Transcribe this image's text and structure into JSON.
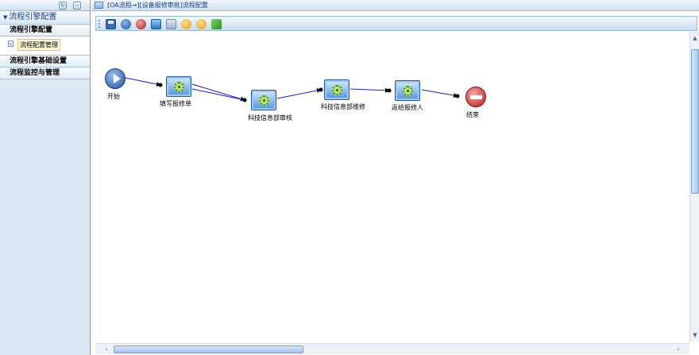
{
  "sidebar": {
    "header_title": "流程引擎配置",
    "items": [
      {
        "label": "流程引擎配置"
      },
      {
        "label": "流程配置管理"
      },
      {
        "label": "流程引擎基础设置"
      },
      {
        "label": "流程监控与管理"
      }
    ]
  },
  "main": {
    "title": "[OA流程→][设备报修审批]流程配置"
  },
  "toolbar": {
    "buttons": [
      {
        "icon": "save-icon"
      },
      {
        "icon": "start-node-icon"
      },
      {
        "icon": "end-node-icon"
      },
      {
        "icon": "task-node-icon"
      },
      {
        "icon": "grid-icon"
      },
      {
        "icon": "undo-icon"
      },
      {
        "icon": "redo-icon"
      },
      {
        "icon": "edit-icon"
      }
    ]
  },
  "flow": {
    "nodes": [
      {
        "id": "start",
        "type": "start",
        "label": "开始"
      },
      {
        "id": "fill",
        "type": "task",
        "label": "填写报修单"
      },
      {
        "id": "review",
        "type": "task",
        "label": "科技信息部审核"
      },
      {
        "id": "repair",
        "type": "task",
        "label": "科技信息部维修"
      },
      {
        "id": "return",
        "type": "task",
        "label": "返给报修人"
      },
      {
        "id": "end",
        "type": "end",
        "label": "结束"
      }
    ],
    "connections": [
      [
        "start",
        "fill"
      ],
      [
        "fill",
        "review"
      ],
      [
        "fill",
        "review"
      ],
      [
        "review",
        "repair"
      ],
      [
        "repair",
        "return"
      ],
      [
        "return",
        "end"
      ]
    ],
    "colors": {
      "connector": "#1a1ad6",
      "task_border": "#1d5aa7",
      "start": "#1e4f98",
      "end": "#b81a1a"
    }
  }
}
